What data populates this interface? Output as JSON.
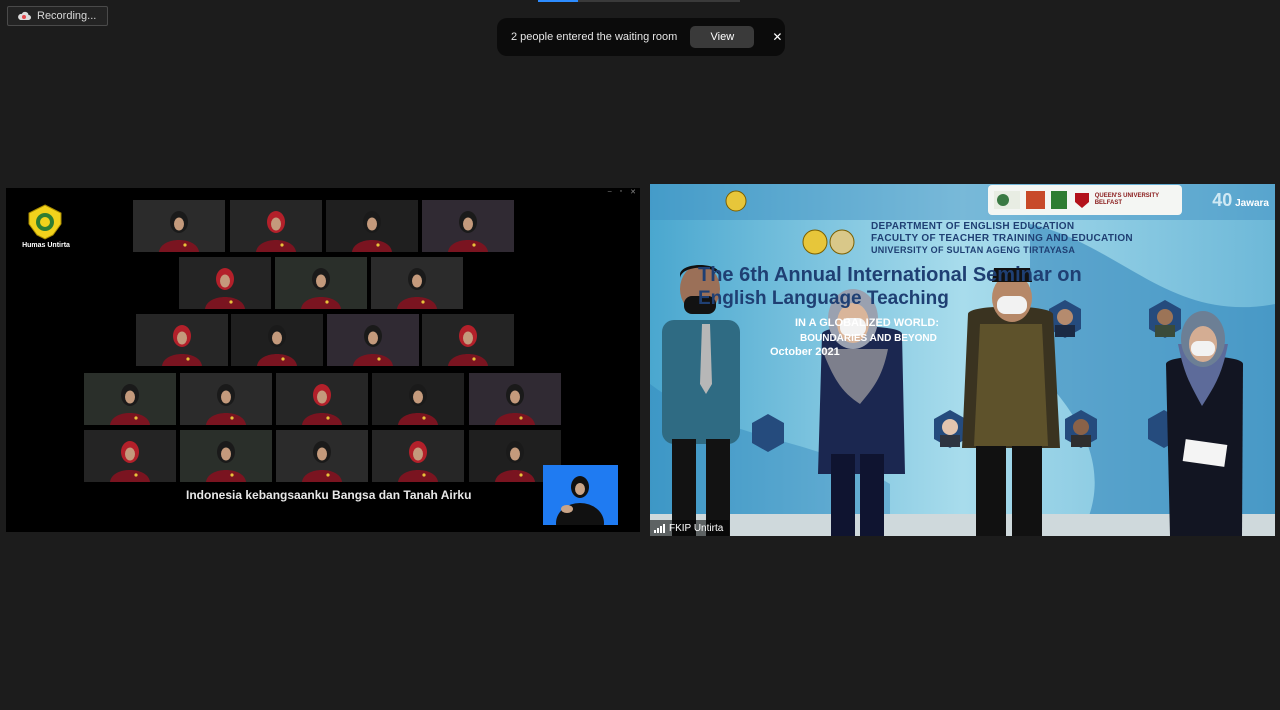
{
  "recording": {
    "label": "Recording..."
  },
  "notification": {
    "message": "2 people entered the waiting room",
    "view_label": "View",
    "close_glyph": "✕"
  },
  "left_video": {
    "logo_label": "Humas Untirta",
    "caption": "Indonesia kebangsaanku Bangsa dan Tanah Airku",
    "window_controls": [
      "–",
      "▫",
      "✕"
    ]
  },
  "right_video": {
    "banner": {
      "line1": "DEPARTMENT OF ENGLISH EDUCATION",
      "line2": "FACULTY OF TEACHER TRAINING AND EDUCATION",
      "line3": "UNIVERSITY OF SULTAN AGENG TIRTAYASA",
      "title1": "The 6th Annual International Seminar on",
      "title2": "English Language Teaching",
      "theme1": "IN A GLOBALIZED WORLD:",
      "theme2": "BOUNDARIES AND BEYOND",
      "date": "October 2021",
      "partner_name": "QUEEN'S UNIVERSITY BELFAST",
      "brand_number": "40",
      "brand_name": "Jawara"
    },
    "participant_name": "FKIP Untirta"
  },
  "colors": {
    "background": "#1c1c1c",
    "accent": "#2d8cff",
    "sign_tile": "#1f7bf2",
    "gown": "#7a1420"
  },
  "icons": [
    "cloud-record-icon",
    "close-icon",
    "signal-icon",
    "university-logo-icon"
  ]
}
